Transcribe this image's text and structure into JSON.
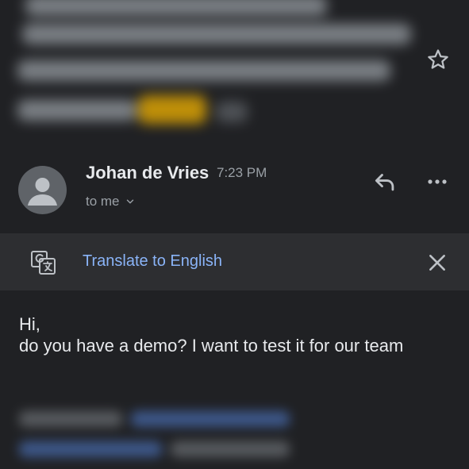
{
  "email": {
    "sender_name": "Johan de Vries",
    "time": "7:23 PM",
    "recipient_label": "to me",
    "icons": {
      "star": "star-outline-icon",
      "reply": "reply-icon",
      "more": "more-horizontal-icon",
      "avatar": "person-avatar-icon",
      "recipient_expand": "chevron-down-icon"
    }
  },
  "translate_bar": {
    "link_label": "Translate to English",
    "icons": {
      "translate": "google-translate-icon",
      "close": "close-icon"
    }
  },
  "body": {
    "greeting": "Hi,",
    "message": "do you have a demo? I want to test it for our team"
  },
  "colors": {
    "background": "#202124",
    "translate_bar": "#2d2e31",
    "link": "#8ab4f8",
    "secondary_text": "#9aa0a6",
    "primary_text": "#e8eaed",
    "highlight": "#f4b400"
  }
}
